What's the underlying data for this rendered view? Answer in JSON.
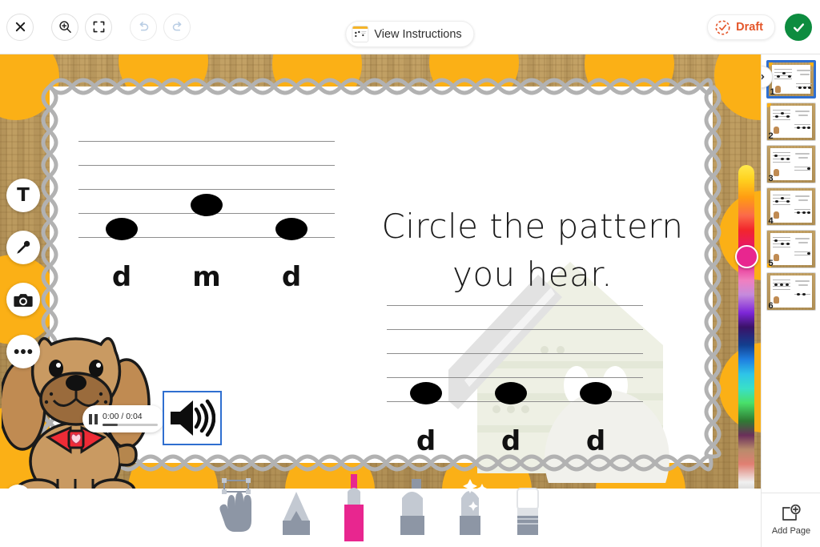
{
  "toolbar": {
    "close_label": "close-icon",
    "zoom_in_label": "zoom-in-icon",
    "fit_screen_label": "fit-to-screen-icon",
    "undo_label": "undo-icon",
    "redo_label": "redo-icon",
    "view_instructions_label": "View Instructions",
    "status_label": "Draft",
    "done_label": "done-check-icon",
    "accent_orange": "#e4562a",
    "accent_green": "#0d8c3f"
  },
  "left_rail": {
    "items": [
      {
        "icon": "text-icon",
        "name": "text-tool",
        "glyph": "T"
      },
      {
        "icon": "microphone-icon",
        "name": "record-audio-tool"
      },
      {
        "icon": "camera-icon",
        "name": "camera-tool"
      },
      {
        "icon": "more-options-icon",
        "name": "more-options-tool"
      }
    ],
    "quote_label": "”"
  },
  "audio": {
    "state": "paused",
    "time_display": "0:00 / 0:04",
    "current_time": "0:00",
    "duration": "0:04",
    "progress_percent": 27,
    "speaker_label": "speaker-icon"
  },
  "worksheet": {
    "prompt_line1": "Circle the pattern",
    "prompt_line2": "you hear.",
    "staff_top": {
      "name": "staff-answer-option-1",
      "syllables": [
        "d",
        "m",
        "d"
      ],
      "note_positions": [
        "low",
        "high",
        "low"
      ]
    },
    "staff_bottom": {
      "name": "staff-answer-option-2",
      "syllables": [
        "d",
        "d",
        "d"
      ],
      "note_positions": [
        "low",
        "low",
        "low"
      ]
    },
    "mascot": "dog-illustration",
    "background": "wood-texture-with-orange-dots"
  },
  "color_picker": {
    "selected_color": "#e8268f",
    "selected_position_percent": 23
  },
  "bottom_tools": [
    {
      "name": "select-hand-tool",
      "label": "Select",
      "color": "#8d96a5",
      "active": false
    },
    {
      "name": "pencil-tool",
      "label": "Pencil",
      "color": "#aeb4bd",
      "active": false
    },
    {
      "name": "marker-tool",
      "label": "Marker",
      "color": "#e8268f",
      "active": true
    },
    {
      "name": "highlighter-tool",
      "label": "Highlighter",
      "color": "#aeb4bd",
      "active": false
    },
    {
      "name": "glitter-pen-tool",
      "label": "Glitter Pen",
      "color": "#aeb4bd",
      "active": false
    },
    {
      "name": "eraser-tool",
      "label": "Eraser",
      "color": "#c9ccd1",
      "active": false
    }
  ],
  "pages_panel": {
    "toggle_label": "collapse-panel-icon",
    "add_page_label": "Add Page",
    "selected_page": 1,
    "pages": [
      {
        "number": "1",
        "selected": true,
        "syllables_top": [
          "d",
          "m",
          "d"
        ],
        "syllables_bottom": [
          "d",
          "d",
          "d"
        ]
      },
      {
        "number": "2",
        "selected": false,
        "syllables_top": [
          "d",
          "m",
          "d"
        ],
        "syllables_bottom": [
          "d",
          "d",
          "d"
        ]
      },
      {
        "number": "3",
        "selected": false,
        "syllables_top": [
          "d",
          "m",
          "d"
        ],
        "syllables_bottom": [
          "d",
          "d",
          "d"
        ]
      },
      {
        "number": "4",
        "selected": false,
        "syllables_top": [
          "d",
          "m",
          "d"
        ],
        "syllables_bottom": [
          "d",
          "d",
          "d"
        ]
      },
      {
        "number": "5",
        "selected": false,
        "syllables_top": [
          "d",
          "m",
          "d"
        ],
        "syllables_bottom": [
          "d",
          "d",
          "d"
        ]
      },
      {
        "number": "6",
        "selected": false,
        "syllables_top": [
          "d",
          "m",
          "d"
        ],
        "syllables_bottom": [
          "d",
          "d",
          "d"
        ]
      }
    ]
  }
}
